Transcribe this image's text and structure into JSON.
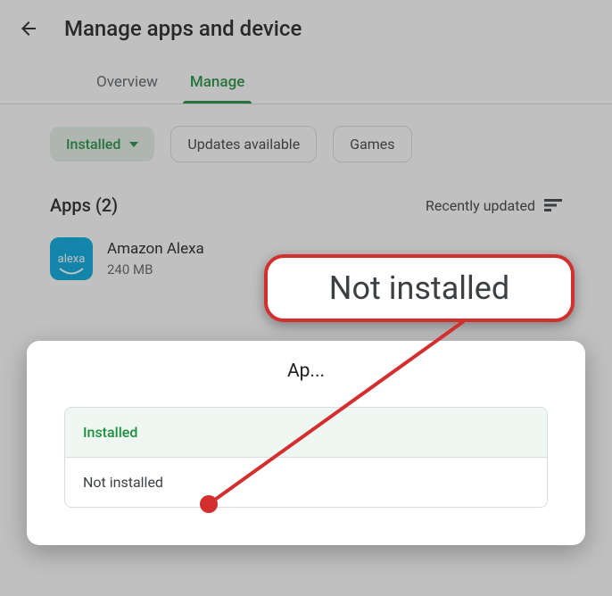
{
  "header": {
    "title": "Manage apps and device"
  },
  "tabs": {
    "overview": "Overview",
    "manage": "Manage"
  },
  "filters": {
    "installed": "Installed",
    "updates": "Updates available",
    "games": "Games"
  },
  "section": {
    "title": "Apps (2)",
    "sort_label": "Recently updated"
  },
  "app": {
    "name": "Amazon Alexa",
    "size": "240 MB",
    "icon_text": "alexa"
  },
  "callout": {
    "text": "Not installed"
  },
  "modal": {
    "title": "Ap...",
    "option_installed": "Installed",
    "option_not_installed": "Not installed"
  }
}
